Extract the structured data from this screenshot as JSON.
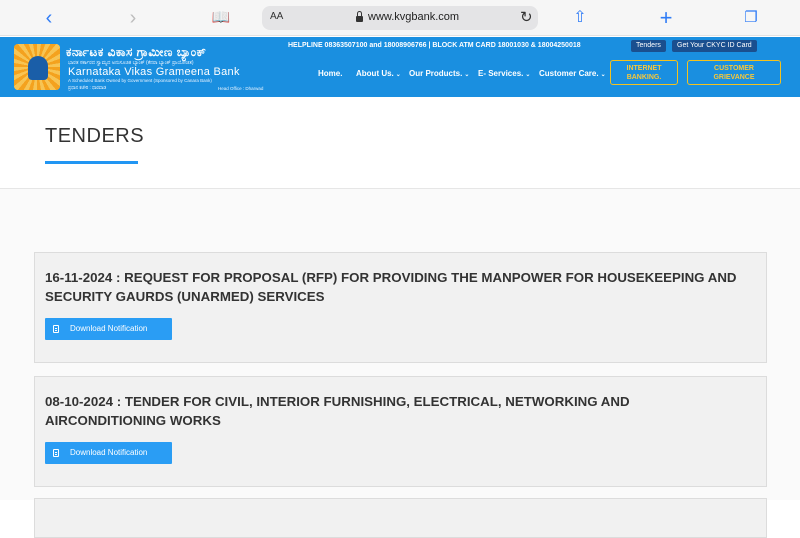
{
  "browser": {
    "text_size_label": "AA",
    "url": "www.kvgbank.com"
  },
  "header": {
    "logo_kannada": "ಕರ್ನಾಟಕ ವಿಕಾಸ ಗ್ರಾಮೀಣ ಬ್ಯಾಂಕ್",
    "logo_kannada_tagline": "ಭಾರತ ಸರ್ಕಾರದ ಸ್ವಾಮ್ಯದ ಅನುಸೂಚಿತ ಬ್ಯಾಂಕ್ (ಕೆನರಾ ಬ್ಯಾಂಕ್ ಪ್ರಾಯೋಜಿತ)",
    "logo_name": "Karnataka Vikas Grameena Bank",
    "logo_tagline": "A Scheduled Bank Owned by Government (Sponsored by Canara Bank)",
    "logo_office_kannada": "ಪ್ರಧಾನ ಕಚೇರಿ : ಧಾರವಾಡ",
    "logo_office": "Head Office : Dharwad",
    "helpline": "HELPLINE 08363507100 and 18008906766  |  BLOCK ATM CARD 18001030 & 18004250018",
    "tenders_tag": "Tenders",
    "ckyc_tag": "Get Your CKYC ID Card",
    "nav": {
      "home": "Home.",
      "about": "About Us.",
      "products": "Our Products.",
      "eservices": "E- Services.",
      "customer_care": "Customer Care."
    },
    "internet_banking": [
      "INTERNET",
      "BANKING."
    ],
    "customer_grievance": [
      "CUSTOMER",
      "GRIEVANCE"
    ]
  },
  "page": {
    "title": "TENDERS"
  },
  "tenders": [
    {
      "title": "16-11-2024 : REQUEST FOR PROPOSAL (RFP) FOR PROVIDING THE MANPOWER FOR HOUSEKEEPING AND SECURITY GAURDS (UNARMED) SERVICES",
      "button": "Download Notification"
    },
    {
      "title": "08-10-2024 : TENDER FOR CIVIL, INTERIOR FURNISHING, ELECTRICAL, NETWORKING AND AIRCONDITIONING WORKS",
      "button": "Download Notification"
    }
  ]
}
